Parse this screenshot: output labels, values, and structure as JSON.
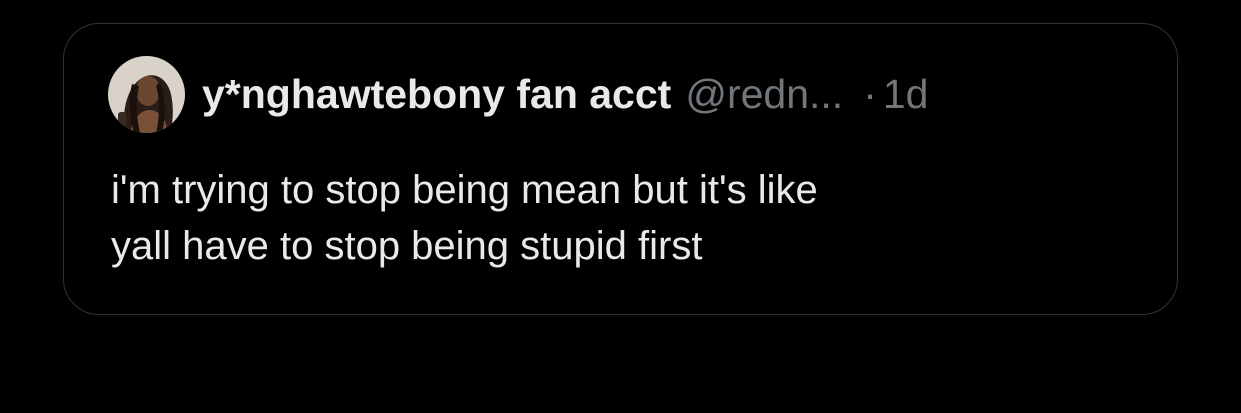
{
  "quote": {
    "display_name": "y*nghawtebony fan acct",
    "handle": "@redn...",
    "separator": "·",
    "timestamp": "1d",
    "avatar_icon": "profile-photo-avatar",
    "text": "i'm trying to stop being mean but it's like\nyall have to stop being stupid first"
  },
  "colors": {
    "background": "#000000",
    "border": "#2f3336",
    "primary_text": "#e7e9ea",
    "secondary_text": "#71767b"
  }
}
